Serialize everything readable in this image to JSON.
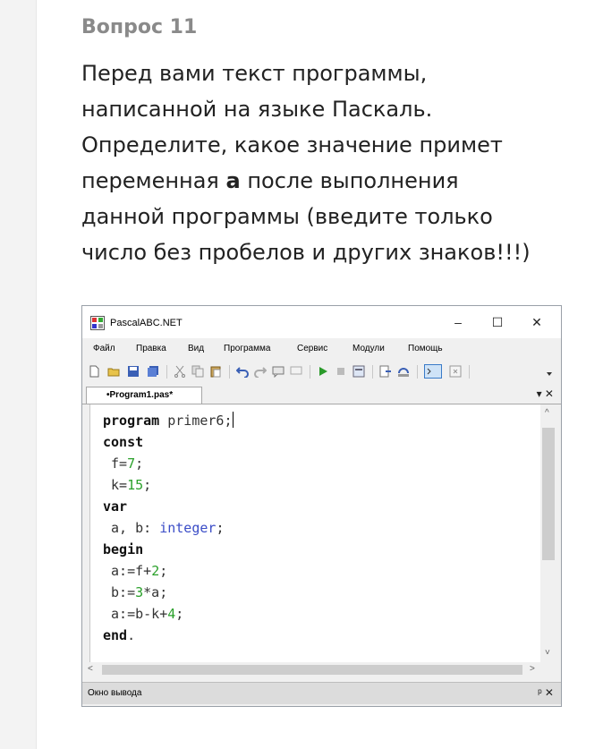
{
  "question": {
    "title": "Вопрос 11",
    "lines": [
      "Перед вами текст программы,",
      "написанной на языке Паскаль.",
      "Определите, какое значение примет",
      "переменная ",
      "число без пробелов и других знаков!!!)"
    ],
    "var_bold": "а",
    "line4_rest": " после выполнения",
    "line5": "данной программы (введите только"
  },
  "ide": {
    "title": "PascalABC.NET",
    "window_buttons": {
      "minimize": "–",
      "maximize": "☐",
      "close": "✕"
    },
    "menu": [
      "Файл",
      "Правка",
      "Вид",
      "Программа",
      "Сервис",
      "Модули",
      "Помощь"
    ],
    "tab_label": "•Program1.pas*",
    "tab_actions": "▾ ✕",
    "code": {
      "l1_kw": "program",
      "l1_rest": " primer6;",
      "l2_kw": "const",
      "l3_a": " f=",
      "l3_n": "7",
      "l3_b": ";",
      "l4_a": " k=",
      "l4_n": "15",
      "l4_b": ";",
      "l5_kw": "var",
      "l6_a": " a, b: ",
      "l6_t": "integer",
      "l6_b": ";",
      "l7_kw": "begin",
      "l8_a": " a:=f+",
      "l8_n": "2",
      "l8_b": ";",
      "l9_a": " b:=",
      "l9_n": "3",
      "l9_b": "*a;",
      "l10_a": " a:=b-k+",
      "l10_n": "4",
      "l10_b": ";",
      "l11_kw": "end",
      "l11_b": "."
    },
    "output_title": "Окно вывода",
    "output_actions": "ᵖ ✕",
    "scroll_up": "^",
    "scroll_down": "˅",
    "scroll_left": "<",
    "scroll_right": ">"
  },
  "colors": {
    "keyword": "#111111",
    "number": "#2aa02a",
    "type": "#3b4dc7",
    "title_gray": "#8a8a8a"
  }
}
